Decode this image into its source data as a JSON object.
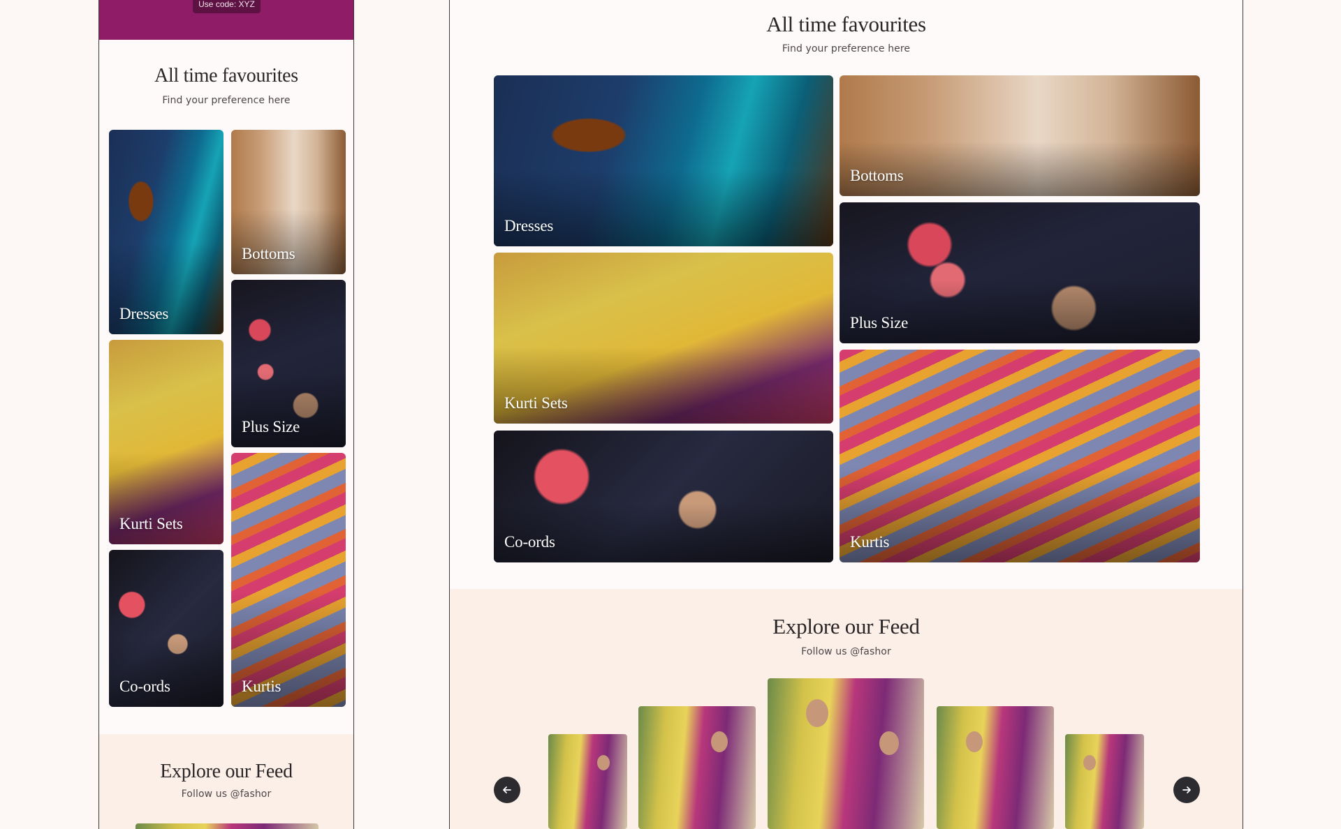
{
  "promo": {
    "code_text": "Use code: XYZ"
  },
  "favourites": {
    "title": "All time favourites",
    "subtitle": "Find your preference here",
    "categories": [
      {
        "label": "Dresses"
      },
      {
        "label": "Bottoms"
      },
      {
        "label": "Plus Size"
      },
      {
        "label": "Kurti Sets"
      },
      {
        "label": "Co-ords"
      },
      {
        "label": "Kurtis"
      }
    ]
  },
  "feed": {
    "title": "Explore our Feed",
    "subtitle": "Follow us @fashor",
    "prev_icon": "arrow-left-icon",
    "next_icon": "arrow-right-icon"
  },
  "colors": {
    "brand": "#8e1c66",
    "page_bg": "#fffafa",
    "feed_bg": "#fcefe8",
    "text": "#2a2526",
    "nav_button": "#2c2b2f"
  }
}
